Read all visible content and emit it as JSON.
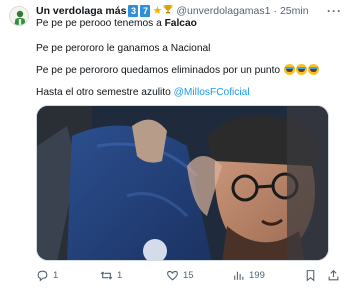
{
  "tweet": {
    "author": {
      "display_name": "Un verdolaga más",
      "badges": [
        "3",
        "7"
      ],
      "handle": "@unverdolagamas1",
      "separator": "·",
      "time": "25min"
    },
    "more_label": "···",
    "lines": {
      "line1_prefix": "Pe pe pe perooo tenemos a ",
      "line1_bold": "Falcao",
      "line2": "Pe pe perororo le ganamos a Nacional",
      "line3": "Pe pe pe perororo quedamos eliminados por un punto",
      "line3_emoji_count": 3,
      "line4_prefix": "Hasta el otro semestre azulito ",
      "line4_mention": "@MillosFCoficial"
    },
    "media": {
      "kind": "photo"
    },
    "actions": {
      "reply_count": "1",
      "retweet_count": "1",
      "like_count": "15",
      "views_count": "199"
    },
    "colors": {
      "link": "#1d9bf0",
      "secondary_text": "#536471",
      "badge": "#2f8fd8"
    },
    "icons": [
      "avatar-icon",
      "star-icon",
      "trophy-icon",
      "more-icon",
      "reply-icon",
      "retweet-icon",
      "like-icon",
      "views-icon",
      "bookmark-icon",
      "share-icon"
    ]
  }
}
